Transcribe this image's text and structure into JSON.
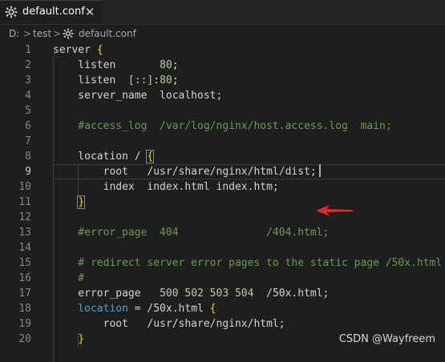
{
  "tab": {
    "label": "default.conf",
    "icon": "gear-icon",
    "close_glyph": "✕"
  },
  "breadcrumb": {
    "items": [
      "D:",
      "test",
      "default.conf"
    ],
    "separator": ">"
  },
  "editor": {
    "active_line": 9,
    "line_numbers": [
      "1",
      "2",
      "3",
      "4",
      "5",
      "6",
      "7",
      "8",
      "9",
      "10",
      "11",
      "12",
      "13",
      "14",
      "15",
      "16",
      "17",
      "18",
      "19",
      "20"
    ],
    "lines": [
      [
        [
          "txt",
          "server "
        ],
        [
          "brace",
          "{"
        ]
      ],
      [
        [
          "txt",
          "    listen       "
        ],
        [
          "num",
          "80"
        ],
        [
          "txt",
          ";"
        ]
      ],
      [
        [
          "txt",
          "    listen  "
        ],
        [
          "num",
          "[::]"
        ],
        [
          "txt",
          ":"
        ],
        [
          "num",
          "80"
        ],
        [
          "txt",
          ";"
        ]
      ],
      [
        [
          "txt",
          "    server_name  localhost;"
        ]
      ],
      [],
      [
        [
          "com",
          "    #access_log  /var/log/nginx/host.access.log  main;"
        ]
      ],
      [],
      [
        [
          "txt",
          "    location / "
        ],
        [
          "bracebox",
          "{"
        ]
      ],
      [
        [
          "txt",
          "        root   /usr/share/nginx/html/dist;"
        ]
      ],
      [
        [
          "txt",
          "        index  index.html index.htm;"
        ]
      ],
      [
        [
          "txt",
          "    "
        ],
        [
          "bracebox",
          "}"
        ]
      ],
      [],
      [
        [
          "com",
          "    #error_page  404              /404.html;"
        ]
      ],
      [],
      [
        [
          "com",
          "    # redirect server error pages to the static page /50x.html"
        ]
      ],
      [
        [
          "com",
          "    #"
        ]
      ],
      [
        [
          "txt",
          "    error_page   "
        ],
        [
          "num",
          "500 502 503 504"
        ],
        [
          "txt",
          "  /50x.html;"
        ]
      ],
      [
        [
          "kw",
          "    location"
        ],
        [
          "txt",
          " = /50x.html "
        ],
        [
          "brace",
          "{"
        ]
      ],
      [
        [
          "txt",
          "        root   /usr/share/nginx/html;"
        ]
      ],
      [
        [
          "txt",
          "    "
        ],
        [
          "brace",
          "}"
        ]
      ]
    ]
  },
  "annotation": {
    "arrow_color": "#e8262a",
    "points_to_line": 9
  },
  "watermark": "CSDN @Wayfreem",
  "colors": {
    "background": "#1e1e1e",
    "text": "#d4d4d4",
    "number": "#b5cea8",
    "comment": "#6a9955",
    "keyword": "#569cd6",
    "bracket": "#ffd700"
  }
}
